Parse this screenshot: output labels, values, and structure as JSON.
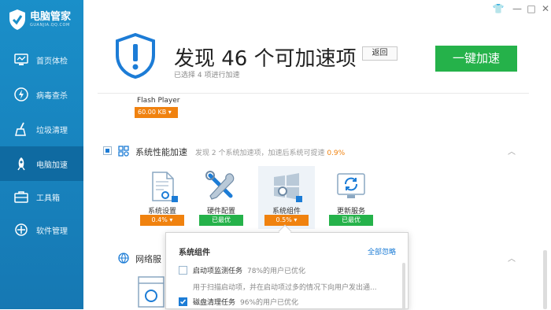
{
  "app": {
    "name": "电脑管家",
    "subtitle": "GUANJIA.QQ.COM"
  },
  "sidebar": {
    "items": [
      {
        "label": "首页体检",
        "icon": "monitor-icon"
      },
      {
        "label": "病毒查杀",
        "icon": "bolt-icon"
      },
      {
        "label": "垃圾清理",
        "icon": "broom-icon"
      },
      {
        "label": "电脑加速",
        "icon": "rocket-icon",
        "active": true
      },
      {
        "label": "工具箱",
        "icon": "toolbox-icon"
      },
      {
        "label": "软件管理",
        "icon": "software-icon"
      }
    ]
  },
  "window_controls": {
    "skin": "👕",
    "min": "—",
    "max": "□",
    "close": "✕"
  },
  "header": {
    "title": "发现 46 个可加速项",
    "subtitle": "已选择 4 项进行加速",
    "back": "返回",
    "speed_up": "一键加速"
  },
  "flash": {
    "label": "Flash Player",
    "size": "60.00 KB ▾"
  },
  "section_perf": {
    "title": "系统性能加速",
    "desc": "发现 2 个系统加速项，加速后系统可提速",
    "pct": "0.9%",
    "caret": "︿"
  },
  "tiles": [
    {
      "label": "系统设置",
      "badge": "0.4%  ▾",
      "icon": "settings-doc-icon",
      "color": "orange"
    },
    {
      "label": "硬件配置",
      "badge": "已最优",
      "icon": "tools-icon",
      "color": "green"
    },
    {
      "label": "系统组件",
      "badge": "0.5%  ▾",
      "icon": "windows-gear-icon",
      "color": "orange"
    },
    {
      "label": "更新服务",
      "badge": "已最优",
      "icon": "refresh-monitor-icon",
      "color": "green"
    }
  ],
  "section_net": {
    "title": "网络服",
    "caret": "︿"
  },
  "popup": {
    "title": "系统组件",
    "ignore_all": "全部忽略",
    "items": [
      {
        "name": "启动项监测任务",
        "meta": "78%的用户已优化",
        "checked": false
      },
      {
        "name": "磁盘清理任务",
        "meta": "96%的用户已优化",
        "checked": true
      }
    ],
    "desc": "用于扫描启动项，并在启动项过多的情况下向用户发出通..."
  }
}
